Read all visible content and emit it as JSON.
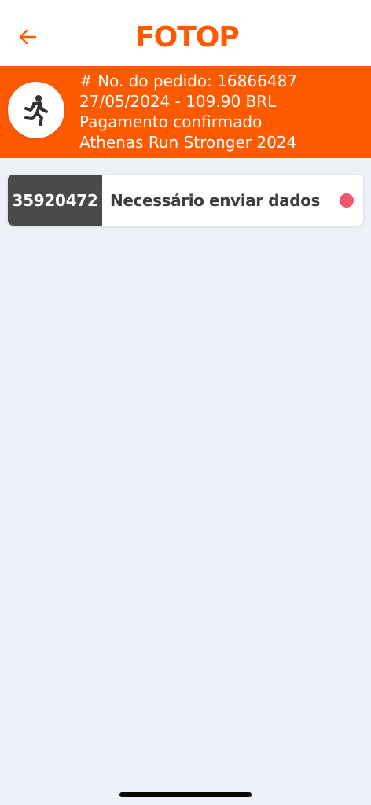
{
  "header": {
    "logo_text": "FOTOP",
    "brand_color": "#ff5a00",
    "back_icon": "arrow-left-icon"
  },
  "order": {
    "number_line": "# No. do pedido: 16866487",
    "date_amount_line": "27/05/2024 - 109.90 BRL",
    "payment_status": "Pagamento confirmado",
    "event_name": "Athenas Run Stronger 2024",
    "icon": "runner-icon"
  },
  "items": [
    {
      "id": "35920472",
      "status": "Necessário enviar dados",
      "status_color": "#f0566a"
    }
  ]
}
